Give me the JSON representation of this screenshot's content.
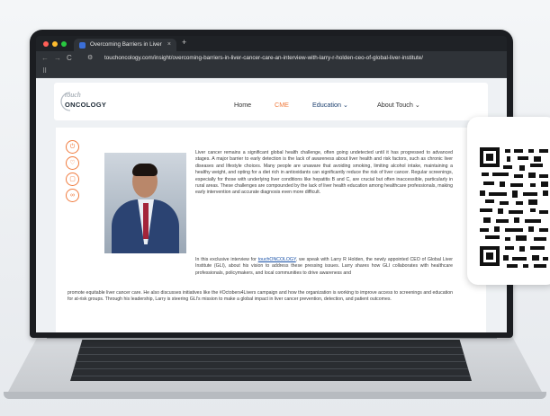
{
  "browser": {
    "tab_title": "Overcoming Barriers in Liver",
    "tab_close": "×",
    "new_tab": "+",
    "url": "touchoncology.com/insight/overcoming-barriers-in-liver-cancer-care-an-interview-with-larry-r-holden-ceo-of-global-liver-institute/",
    "back": "←",
    "forward": "→",
    "reload": "C",
    "apps": "⠿"
  },
  "site": {
    "logo_top": "touch",
    "logo_bottom": "ONCOLOGY",
    "menu": [
      "Home",
      "CME",
      "Education",
      "About Touch"
    ],
    "chevron": "⌄"
  },
  "share_icons": [
    "bookmark-icon",
    "like-icon",
    "comment-icon",
    "link-icon"
  ],
  "article": {
    "p1": "Liver cancer remains a significant global health challenge, often going undetected until it has progressed to advanced stages. A major barrier to early detection is the lack of awareness about liver health and risk factors, such as chronic liver diseases and lifestyle choices. Many people are unaware that avoiding smoking, limiting alcohol intake, maintaining a healthy weight, and opting for a diet rich in antioxidants can significantly reduce the risk of liver cancer. Regular screenings, especially for those with underlying liver conditions like hepatitis B and C, are crucial but often inaccessible, particularly in rural areas. These challenges are compounded by the lack of liver health education among healthcare professionals, making early intervention and accurate diagnosis even more difficult.",
    "p2_before": "In this exclusive interview for ",
    "p2_link": "touchONCOLOGY",
    "p2_after": ", we speak with Larry R Holden, the newly appointed CEO of Global Liver Institute (GLI), about his vision to address these pressing issues. Larry shares how GLI collaborates with healthcare professionals, policymakers, and local communities to drive awareness and",
    "p3": "promote equitable liver cancer care. He also discusses initiatives like the #Octobers4Livers campaign and how the organization is working to improve access to screenings and education for at-risk groups. Through his leadership, Larry is steering GLI's mission to make a global impact in liver cancer prevention, detection, and patient outcomes."
  },
  "colors": {
    "accent": "#f07c3f",
    "link": "#1a52a8",
    "nav_text": "#333333"
  }
}
